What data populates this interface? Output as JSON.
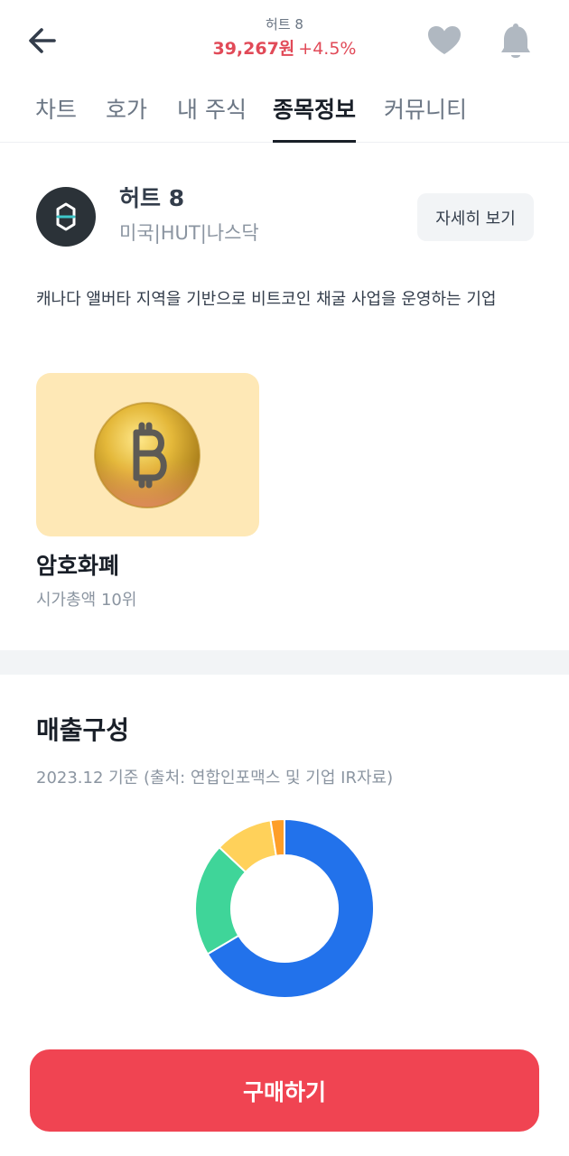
{
  "header": {
    "stock_name": "허트 8",
    "price": "39,267원",
    "change": "+4.5%",
    "price_color": "#e14a58"
  },
  "icons": {
    "back": "back-arrow-icon",
    "favorite": "heart-icon",
    "notification": "bell-icon"
  },
  "tabs": [
    {
      "label": "차트",
      "active": false
    },
    {
      "label": "호가",
      "active": false
    },
    {
      "label": "내 주식",
      "active": false
    },
    {
      "label": "종목정보",
      "active": true
    },
    {
      "label": "커뮤니티",
      "active": false
    }
  ],
  "company": {
    "name": "허트 8",
    "meta": "미국|HUT|나스닥",
    "detail_button": "자세히 보기",
    "description": "캐나다 앨버타 지역을 기반으로 비트코인 채굴 사업을 운영하는 기업"
  },
  "category": {
    "title": "암호화폐",
    "subtitle": "시가총액 10위",
    "icon": "bitcoin-coin-icon",
    "card_color": "#fee8b6"
  },
  "revenue": {
    "title": "매출구성",
    "subtitle": "2023.12 기준 (출처: 연합인포맥스 및 기업 IR자료)"
  },
  "chart_data": {
    "type": "pie",
    "donut": true,
    "slices": [
      {
        "value": 66.5,
        "color": "#2272eb"
      },
      {
        "value": 20.5,
        "color": "#3fd599"
      },
      {
        "value": 10.5,
        "color": "#ffd15a"
      },
      {
        "value": 2.5,
        "color": "#fe9e28"
      }
    ]
  },
  "buy_button": {
    "label": "구매하기",
    "color": "#f04452"
  }
}
